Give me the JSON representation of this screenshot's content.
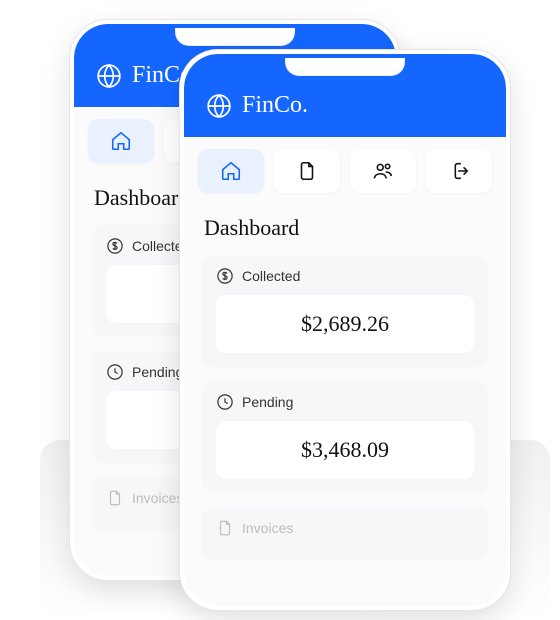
{
  "app": {
    "name": "FinCo."
  },
  "nav": {
    "items": [
      {
        "id": "home",
        "icon": "home-icon",
        "active": true
      },
      {
        "id": "documents",
        "icon": "document-icon",
        "active": false
      },
      {
        "id": "customers",
        "icon": "users-icon",
        "active": false
      },
      {
        "id": "logout",
        "icon": "logout-icon",
        "active": false
      }
    ]
  },
  "page": {
    "title": "Dashboard"
  },
  "cards": {
    "collected": {
      "label": "Collected",
      "value": "$2,689.26"
    },
    "pending": {
      "label": "Pending",
      "value": "$3,468.09"
    },
    "invoices": {
      "label": "Invoices"
    }
  },
  "colors": {
    "brand": "#1466ff",
    "nav_active_bg": "#e9f1ff"
  }
}
